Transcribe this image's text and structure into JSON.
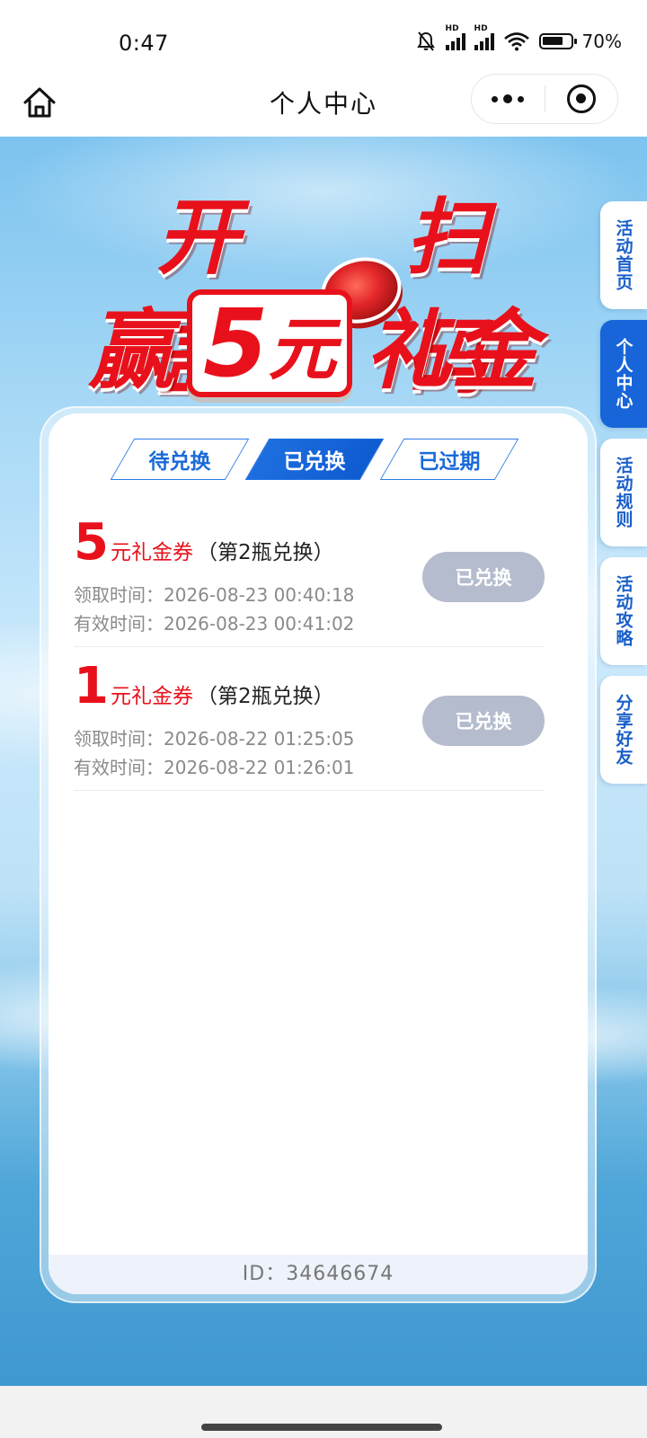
{
  "status_bar": {
    "time": "0:47",
    "battery": "70%",
    "icons": [
      "mute-icon",
      "signal-hd-icon",
      "signal-hd-icon",
      "wifi-icon",
      "battery-icon"
    ]
  },
  "nav": {
    "title": "个人中心"
  },
  "banner": {
    "line1_a": "开盖",
    "line1_b": "扫码",
    "line2_prefix": "赢",
    "amount": "5",
    "amount_unit": "元",
    "line2_suffix": "礼金"
  },
  "tabs": [
    {
      "label": "待兑换",
      "active": false
    },
    {
      "label": "已兑换",
      "active": true
    },
    {
      "label": "已过期",
      "active": false
    }
  ],
  "coupons": [
    {
      "amount": "5",
      "name": "元礼金券",
      "note": "（第2瓶兑换）",
      "received": "领取时间：2026-08-23 00:40:18",
      "valid": "有效时间：2026-08-23 00:41:02",
      "button": "已兑换"
    },
    {
      "amount": "1",
      "name": "元礼金券",
      "note": "（第2瓶兑换）",
      "received": "领取时间：2026-08-22 01:25:05",
      "valid": "有效时间：2026-08-22 01:26:01",
      "button": "已兑换"
    }
  ],
  "footer": {
    "id_text": "ID：34646674"
  },
  "side_tabs": [
    {
      "label": "活动首页",
      "active": false
    },
    {
      "label": "个人中心",
      "active": true
    },
    {
      "label": "活动规则",
      "active": false
    },
    {
      "label": "活动攻略",
      "active": false
    },
    {
      "label": "分享好友",
      "active": false
    }
  ],
  "colors": {
    "accent_red": "#e8111b",
    "accent_blue": "#1765d9",
    "disabled_button": "#b4bccd"
  }
}
